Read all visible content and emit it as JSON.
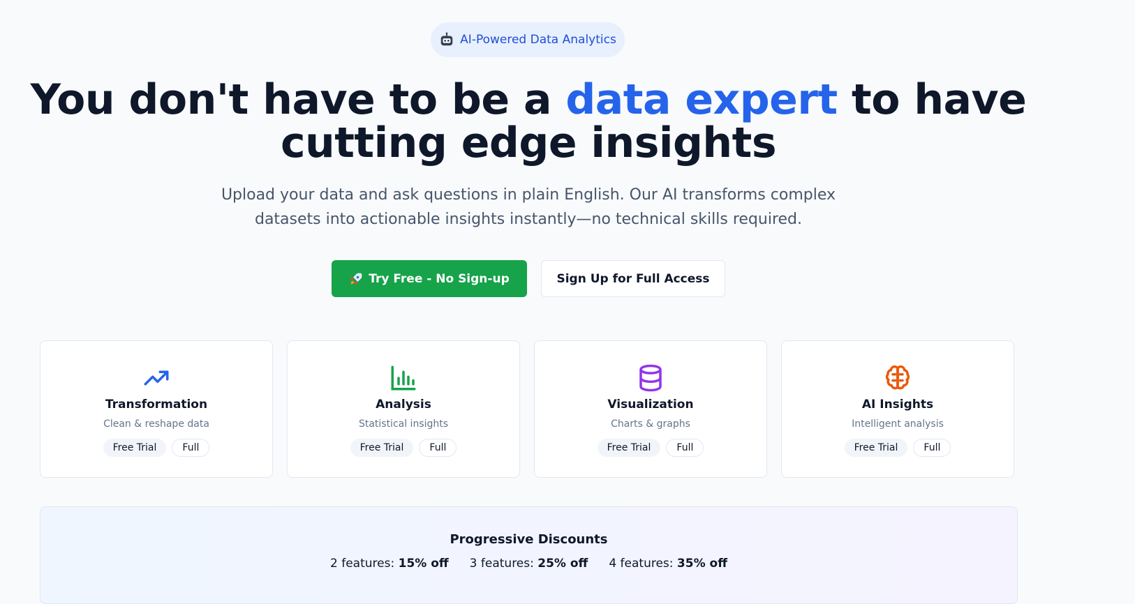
{
  "badge": {
    "label": "AI-Powered Data Analytics",
    "icon": "robot-icon"
  },
  "hero": {
    "headline_pre": "You don't have to be a ",
    "headline_accent": "data expert",
    "headline_mid": " to have",
    "headline_line2": "cutting edge insights",
    "subtitle": "Upload your data and ask questions in plain English. Our AI transforms complex datasets into actionable insights instantly—no technical skills required.",
    "accent_color": "#2563eb"
  },
  "actions": {
    "primary_label": "Try Free - No Sign-up",
    "primary_icon": "rocket-icon",
    "primary_color": "#16a34a",
    "secondary_label": "Sign Up for Full Access"
  },
  "features": [
    {
      "title": "Transformation",
      "desc": "Clean & reshape data",
      "trial": "Free Trial",
      "full": "Full",
      "icon": "trending-up-icon",
      "color": "#2563eb"
    },
    {
      "title": "Analysis",
      "desc": "Statistical insights",
      "trial": "Free Trial",
      "full": "Full",
      "icon": "bar-chart-icon",
      "color": "#16a34a"
    },
    {
      "title": "Visualization",
      "desc": "Charts & graphs",
      "trial": "Free Trial",
      "full": "Full",
      "icon": "database-icon",
      "color": "#9333ea"
    },
    {
      "title": "AI Insights",
      "desc": "Intelligent analysis",
      "trial": "Free Trial",
      "full": "Full",
      "icon": "brain-icon",
      "color": "#ea580c"
    }
  ],
  "discounts": {
    "title": "Progressive Discounts",
    "tiers": [
      {
        "label": "2 features:",
        "value": "15% off"
      },
      {
        "label": "3 features:",
        "value": "25% off"
      },
      {
        "label": "4 features:",
        "value": "35% off"
      }
    ]
  }
}
